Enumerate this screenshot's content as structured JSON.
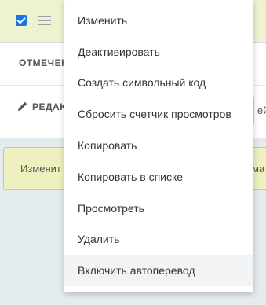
{
  "background": {
    "marked_label": "ОТМЕЧЕН",
    "edit_label": "РЕДАК",
    "right_fragment": "ейс",
    "yellow_left": "Изменит",
    "yellow_right": "ма"
  },
  "menu": {
    "items": [
      {
        "label": "Изменить"
      },
      {
        "label": "Деактивировать"
      },
      {
        "label": "Создать символьный код"
      },
      {
        "label": "Сбросить счетчик просмотров"
      },
      {
        "label": "Копировать"
      },
      {
        "label": "Копировать в списке"
      },
      {
        "label": "Просмотреть"
      },
      {
        "label": "Удалить"
      },
      {
        "label": "Включить автоперевод"
      }
    ],
    "hovered_index": 8
  },
  "colors": {
    "checkbox": "#1a73e8",
    "selected_row": "#eef2cf",
    "yellow_button": "#eef0c0"
  },
  "icons": [
    "checkbox-checked-icon",
    "hamburger-menu-icon",
    "pencil-icon"
  ]
}
